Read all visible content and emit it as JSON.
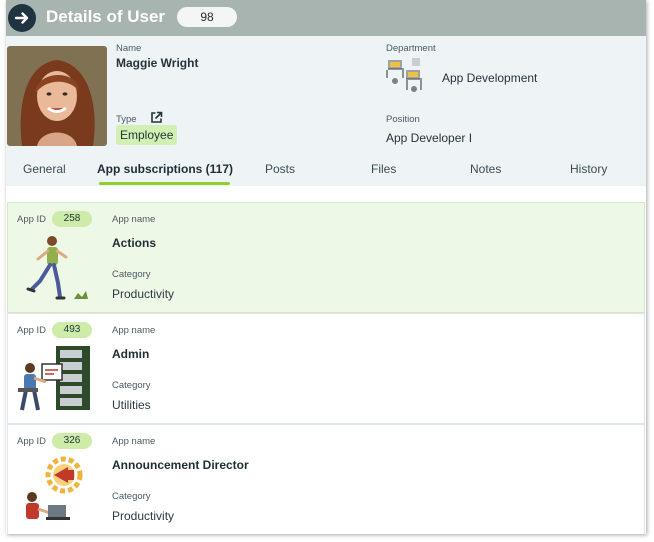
{
  "header": {
    "title": "Details of User",
    "count": "98"
  },
  "user": {
    "name_label": "Name",
    "name": "Maggie Wright",
    "type_label": "Type",
    "type": "Employee",
    "department_label": "Department",
    "department": "App Development",
    "position_label": "Position",
    "position": "App Developer I"
  },
  "tabs": [
    {
      "label": "General",
      "active": false
    },
    {
      "label": "App subscriptions (117)",
      "active": true
    },
    {
      "label": "Posts",
      "active": false
    },
    {
      "label": "Files",
      "active": false
    },
    {
      "label": "Notes",
      "active": false
    },
    {
      "label": "History",
      "active": false
    }
  ],
  "list": {
    "id_label": "App ID",
    "name_label": "App name",
    "category_label": "Category",
    "rows": [
      {
        "id": "258",
        "name": "Actions",
        "category": "Productivity",
        "illustration": "running-person-icon"
      },
      {
        "id": "493",
        "name": "Admin",
        "category": "Utilities",
        "illustration": "server-admin-icon"
      },
      {
        "id": "326",
        "name": "Announcement Director",
        "category": "Productivity",
        "illustration": "megaphone-gear-icon"
      }
    ]
  },
  "colors": {
    "header_bg": "#a8b4b0",
    "accent": "#8fd12a",
    "badge": "#cdeca9",
    "selected_row": "#eef8e6"
  }
}
